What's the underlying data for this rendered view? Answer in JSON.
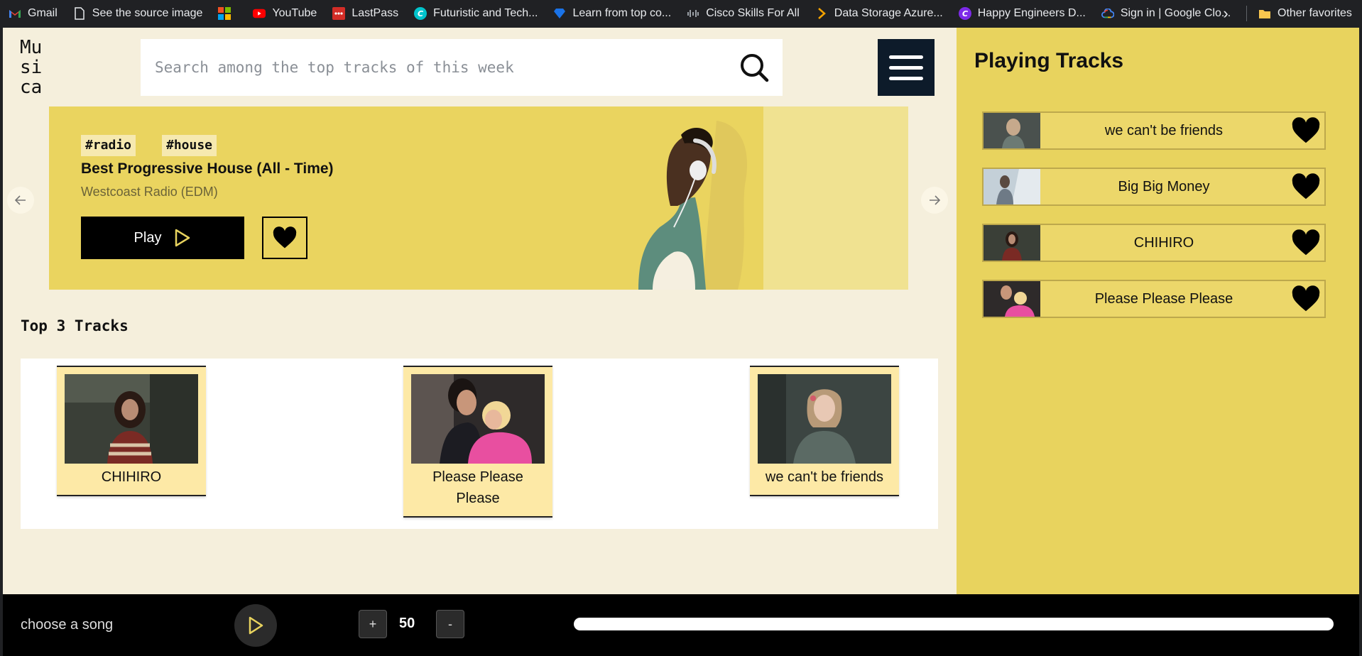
{
  "bookmarks": {
    "items": [
      {
        "label": "Gmail",
        "icon": "gmail-icon"
      },
      {
        "label": "See the source image",
        "icon": "page-icon"
      },
      {
        "label": "",
        "icon": "microsoft-icon"
      },
      {
        "label": "YouTube",
        "icon": "youtube-icon"
      },
      {
        "label": "LastPass",
        "icon": "lastpass-icon"
      },
      {
        "label": "Futuristic and Tech...",
        "icon": "canva-icon"
      },
      {
        "label": "Learn from top co...",
        "icon": "diamond-icon"
      },
      {
        "label": "Cisco Skills For All",
        "icon": "cisco-icon"
      },
      {
        "label": "Data Storage Azure...",
        "icon": "chevron-icon"
      },
      {
        "label": "Happy Engineers D...",
        "icon": "canva-icon"
      },
      {
        "label": "Sign in | Google Clo...",
        "icon": "google-cloud-icon"
      }
    ],
    "other": "Other favorites"
  },
  "app": {
    "logo": "Musica",
    "search": {
      "placeholder": "Search among the top tracks of this week"
    }
  },
  "hero": {
    "tags": [
      "#radio",
      "#house"
    ],
    "title": "Best Progressive House (All - Time)",
    "subtitle": "Westcoast Radio (EDM)",
    "play_label": "Play"
  },
  "top_tracks": {
    "title": "Top 3 Tracks",
    "items": [
      {
        "title": "CHIHIRO"
      },
      {
        "title": "Please Please Please"
      },
      {
        "title": "we can't be friends"
      }
    ]
  },
  "playing": {
    "title": "Playing Tracks",
    "items": [
      {
        "title": "we can't be friends"
      },
      {
        "title": "Big Big Money"
      },
      {
        "title": "CHIHIRO"
      },
      {
        "title": "Please Please Please"
      }
    ]
  },
  "player": {
    "status": "choose a song",
    "plus": "+",
    "minus": "-",
    "volume": "50"
  },
  "colors": {
    "accent_yellow": "#e8d35e",
    "hero_yellow": "#ead45f",
    "card_yellow": "#fde9a6",
    "navy": "#0d1b2a",
    "background": "#f5efdc"
  }
}
